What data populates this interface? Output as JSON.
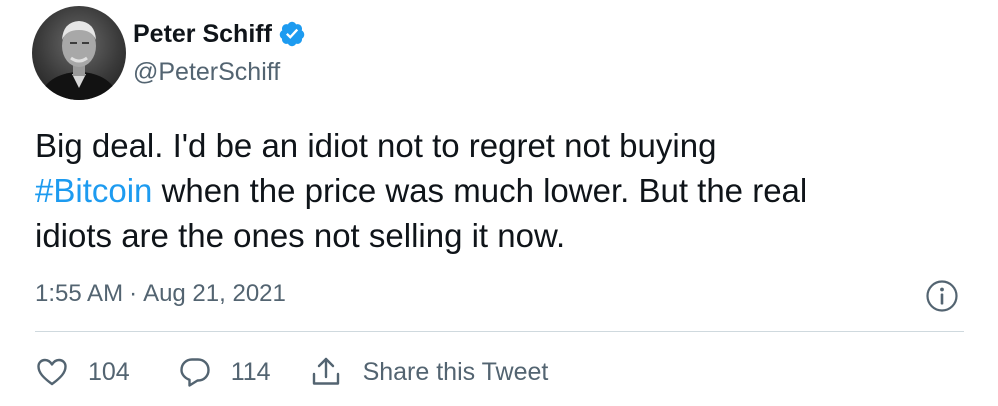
{
  "author": {
    "display_name": "Peter Schiff",
    "handle": "@PeterSchiff",
    "verified": true,
    "verified_color": "#1d9bf0"
  },
  "tweet": {
    "lines": [
      [
        "Big deal.  I'd be an idiot not to regret not buying"
      ],
      [
        "#Bitcoin",
        " when the price was much lower.  But the real"
      ],
      [
        "idiots are the ones not selling it now."
      ]
    ],
    "hashtag": "#Bitcoin",
    "hashtag_color": "#1d9bf0",
    "time": "1:55 AM",
    "separator": "·",
    "date": "Aug 21, 2021"
  },
  "actions": {
    "like_count": "104",
    "reply_count": "114",
    "share_label": "Share this Tweet"
  },
  "icons": {
    "avatar": "profile-photo",
    "verified": "verified-badge-icon",
    "info": "info-icon",
    "like": "heart-icon",
    "reply": "speech-bubble-icon",
    "share": "share-icon"
  }
}
